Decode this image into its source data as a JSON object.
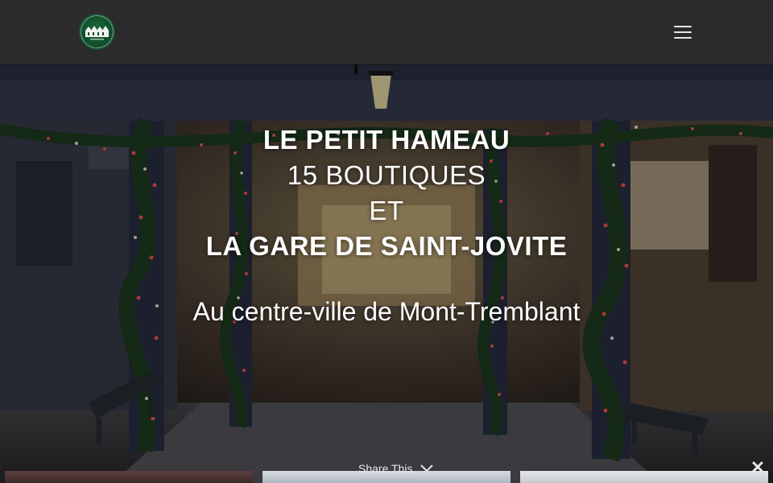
{
  "header": {
    "logo_alt": "Le Petit Hameau logo",
    "menu_icon": "hamburger-menu-icon"
  },
  "hero": {
    "line1": "LE PETIT HAMEAU",
    "line2": "15 BOUTIQUES",
    "line3": "ET",
    "line4": "LA GARE DE SAINT-JOVITE",
    "tagline": "Au centre-ville de Mont-Tremblant"
  },
  "share": {
    "label": "Share This",
    "chevron_icon": "chevron-down-icon",
    "close_icon": "close-icon"
  },
  "colors": {
    "header_bg": "#2b2b2b",
    "text": "#ffffff",
    "logo_green": "#0f4c2a",
    "light_red": "#ff5a5a",
    "garland_green": "#1f3f22"
  }
}
